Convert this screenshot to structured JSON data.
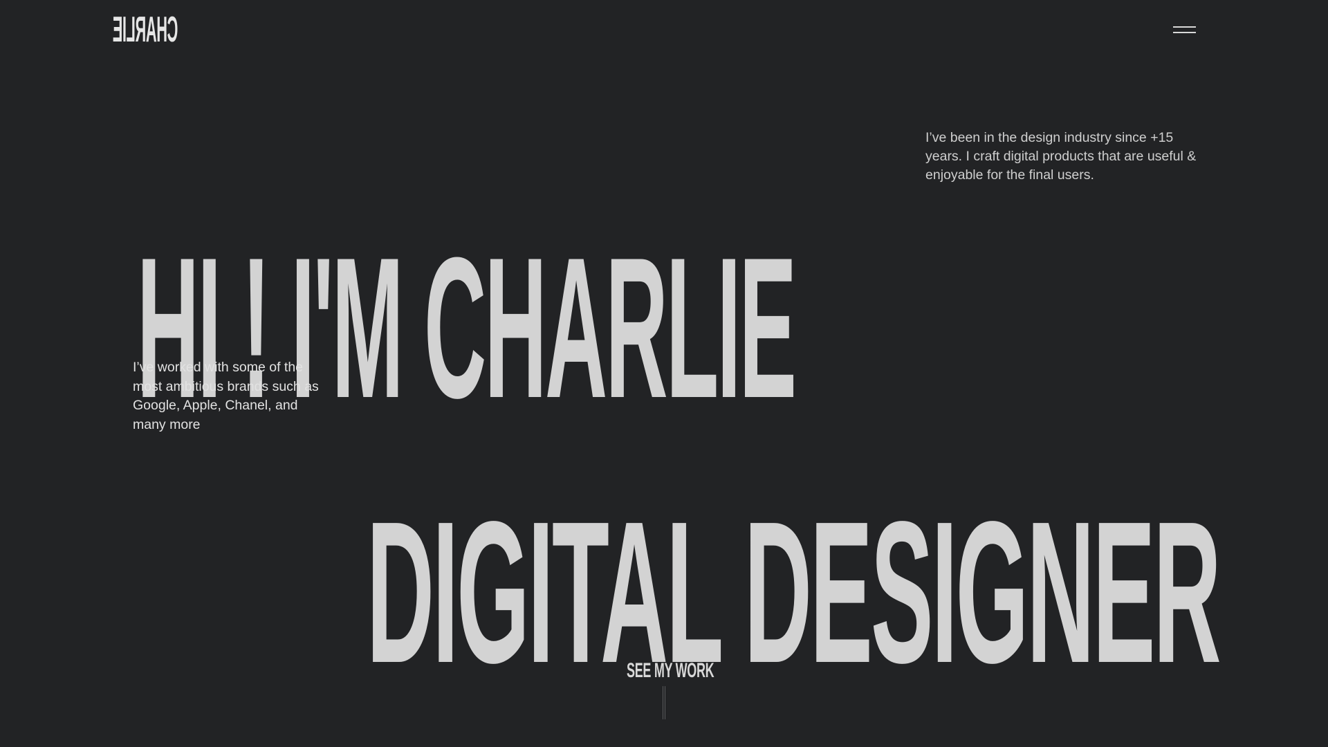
{
  "header": {
    "logo_text": "CHARLIE",
    "menu_icon": "hamburger-menu-icon"
  },
  "hero": {
    "headline_line1": "HI ! I'M CHARLIE",
    "headline_line2": "DIGITAL DESIGNER",
    "intro": "I’ve been in the design industry since +15 years. I craft digital products that are useful & enjoyable for the final users.",
    "brands": "I’ve worked with some of the most ambitious brands such as Google, Apple, Chanel, and many more"
  },
  "cta": {
    "label": "SEE MY WORK"
  },
  "colors": {
    "background": "#222325",
    "text": "#d3d3d3"
  }
}
